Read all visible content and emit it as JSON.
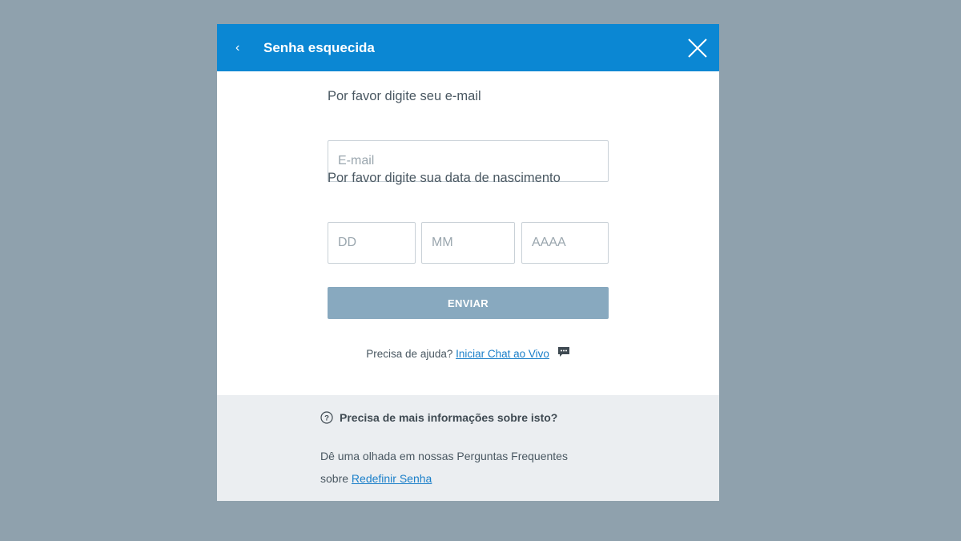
{
  "header": {
    "back_glyph": "‹",
    "title": "Senha esquecida"
  },
  "form": {
    "email_label": "Por favor digite seu e-mail",
    "email_placeholder": "E-mail",
    "dob_label": "Por favor digite sua data de nascimento",
    "day_placeholder": "DD",
    "month_placeholder": "MM",
    "year_placeholder": "AAAA",
    "submit_label": "ENVIAR"
  },
  "help": {
    "prefix": "Precisa de ajuda?",
    "link": "Iniciar Chat ao Vivo"
  },
  "faq": {
    "heading": "Precisa de mais informações sobre isto?",
    "body_line1": "Dê uma olhada em nossas Perguntas Frequentes",
    "body_prefix": "sobre",
    "link": "Redefinir Senha"
  },
  "colors": {
    "header_bg": "#0b87d3",
    "button_bg": "#88a9bf",
    "link": "#1a7fc9",
    "backdrop": "#8fa1ad"
  },
  "icons": {
    "back": "chevron-left-icon",
    "close": "close-icon",
    "chat": "chat-bubble-icon",
    "question": "question-circle-icon"
  }
}
